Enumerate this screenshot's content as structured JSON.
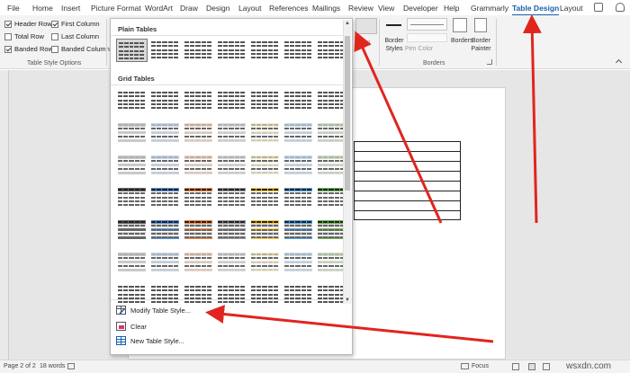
{
  "tabs": [
    "File",
    "Home",
    "Insert",
    "Picture Format",
    "WordArt",
    "Draw",
    "Design",
    "Layout",
    "References",
    "Mailings",
    "Review",
    "View",
    "Developer",
    "Help",
    "Grammarly",
    "Table Design",
    "Layout"
  ],
  "active_tab": "Table Design",
  "table_style_options": {
    "header_row": "Header Row",
    "first_column": "First Column",
    "total_row": "Total Row",
    "last_column": "Last Column",
    "banded_rows": "Banded Rows",
    "banded_columns": "Banded Columns",
    "group_label": "Table Style Options"
  },
  "borders_group": {
    "shading": "ding",
    "border_styles": "Border Styles",
    "pen_color": "Pen Color",
    "borders": "Borders",
    "border_painter": "Border Painter",
    "group_label": "Borders"
  },
  "gallery": {
    "plain_tables": "Plain Tables",
    "grid_tables": "Grid Tables"
  },
  "menu": {
    "modify": "Modify Table Style...",
    "clear": "Clear",
    "new": "New Table Style..."
  },
  "status": {
    "page": "Page 2 of 2",
    "words": "18 words",
    "focus": "Focus"
  },
  "watermark": "wsxdn.com",
  "colors": {
    "accent": "#1b5eab",
    "arrow": "#e0251f"
  }
}
